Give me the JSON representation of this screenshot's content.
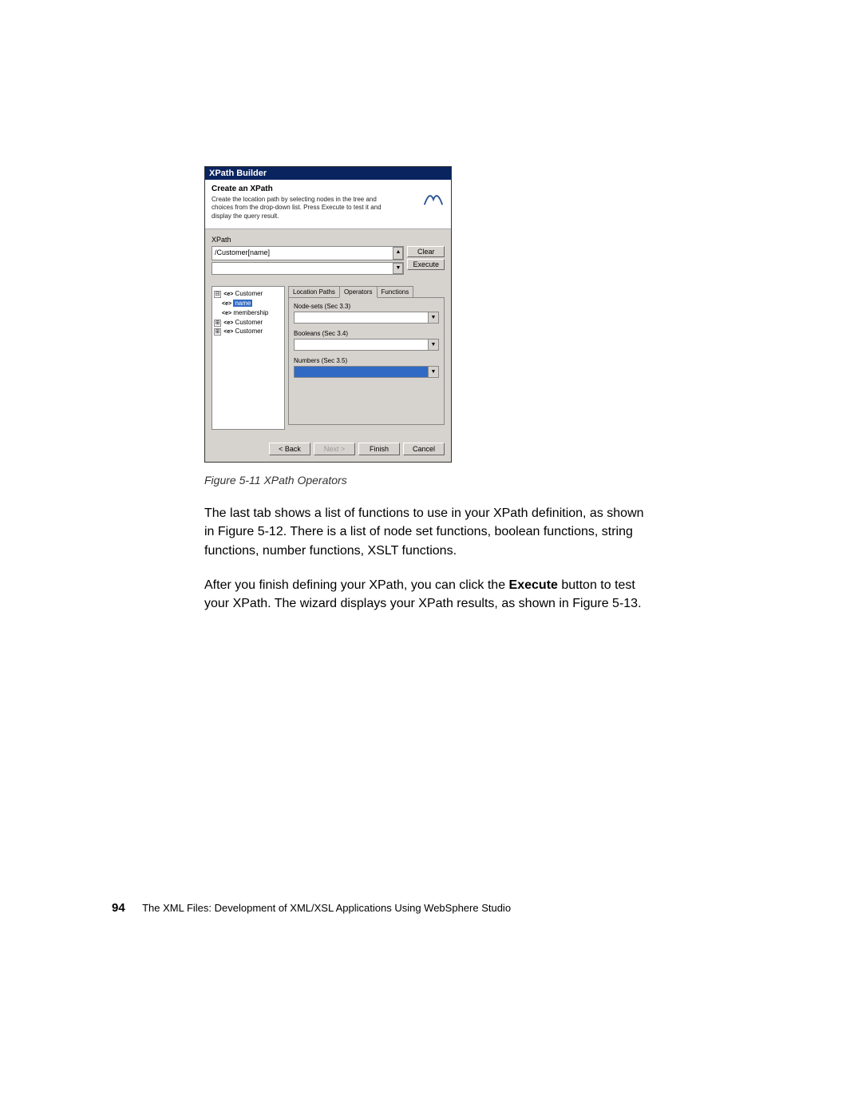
{
  "dialog": {
    "title": "XPath Builder",
    "headerTitle": "Create an XPath",
    "headerDesc": "Create the location path by selecting nodes in the tree and choices from the drop-down list. Press Execute to test it and display the query result.",
    "xpathLabel": "XPath",
    "xpathValue": "/Customer[name]",
    "clearBtn": "Clear",
    "executeBtn": "Execute",
    "tree": {
      "n0": {
        "exp": "⊟",
        "tag": "<e>",
        "name": "Customer"
      },
      "n1": {
        "tag": "<e>",
        "name": "name"
      },
      "n2": {
        "tag": "<e>",
        "name": "membership"
      },
      "n3": {
        "exp": "⊞",
        "tag": "<e>",
        "name": "Customer"
      },
      "n4": {
        "exp": "⊞",
        "tag": "<e>",
        "name": "Customer"
      }
    },
    "tabs": {
      "t0": "Location Paths",
      "t1": "Operators",
      "t2": "Functions"
    },
    "ops": {
      "l0": "Node-sets (Sec 3.3)",
      "l1": "Booleans (Sec 3.4)",
      "l2": "Numbers (Sec 3.5)"
    },
    "wizard": {
      "back": "< Back",
      "next": "Next >",
      "finish": "Finish",
      "cancel": "Cancel"
    }
  },
  "caption": "Figure 5-11   XPath Operators",
  "para1a": "The last tab shows a list of functions to use in your XPath definition, as shown in Figure 5-12. There is a list of node set functions, boolean functions, string functions, number functions, XSLT functions.",
  "para2a": "After you finish defining your XPath, you can click the ",
  "para2b": "Execute",
  "para2c": " button to test your XPath. The wizard displays your XPath results, as shown in Figure 5-13.",
  "footer": {
    "page": "94",
    "title": "The XML Files:   Development of XML/XSL Applications Using WebSphere Studio"
  }
}
